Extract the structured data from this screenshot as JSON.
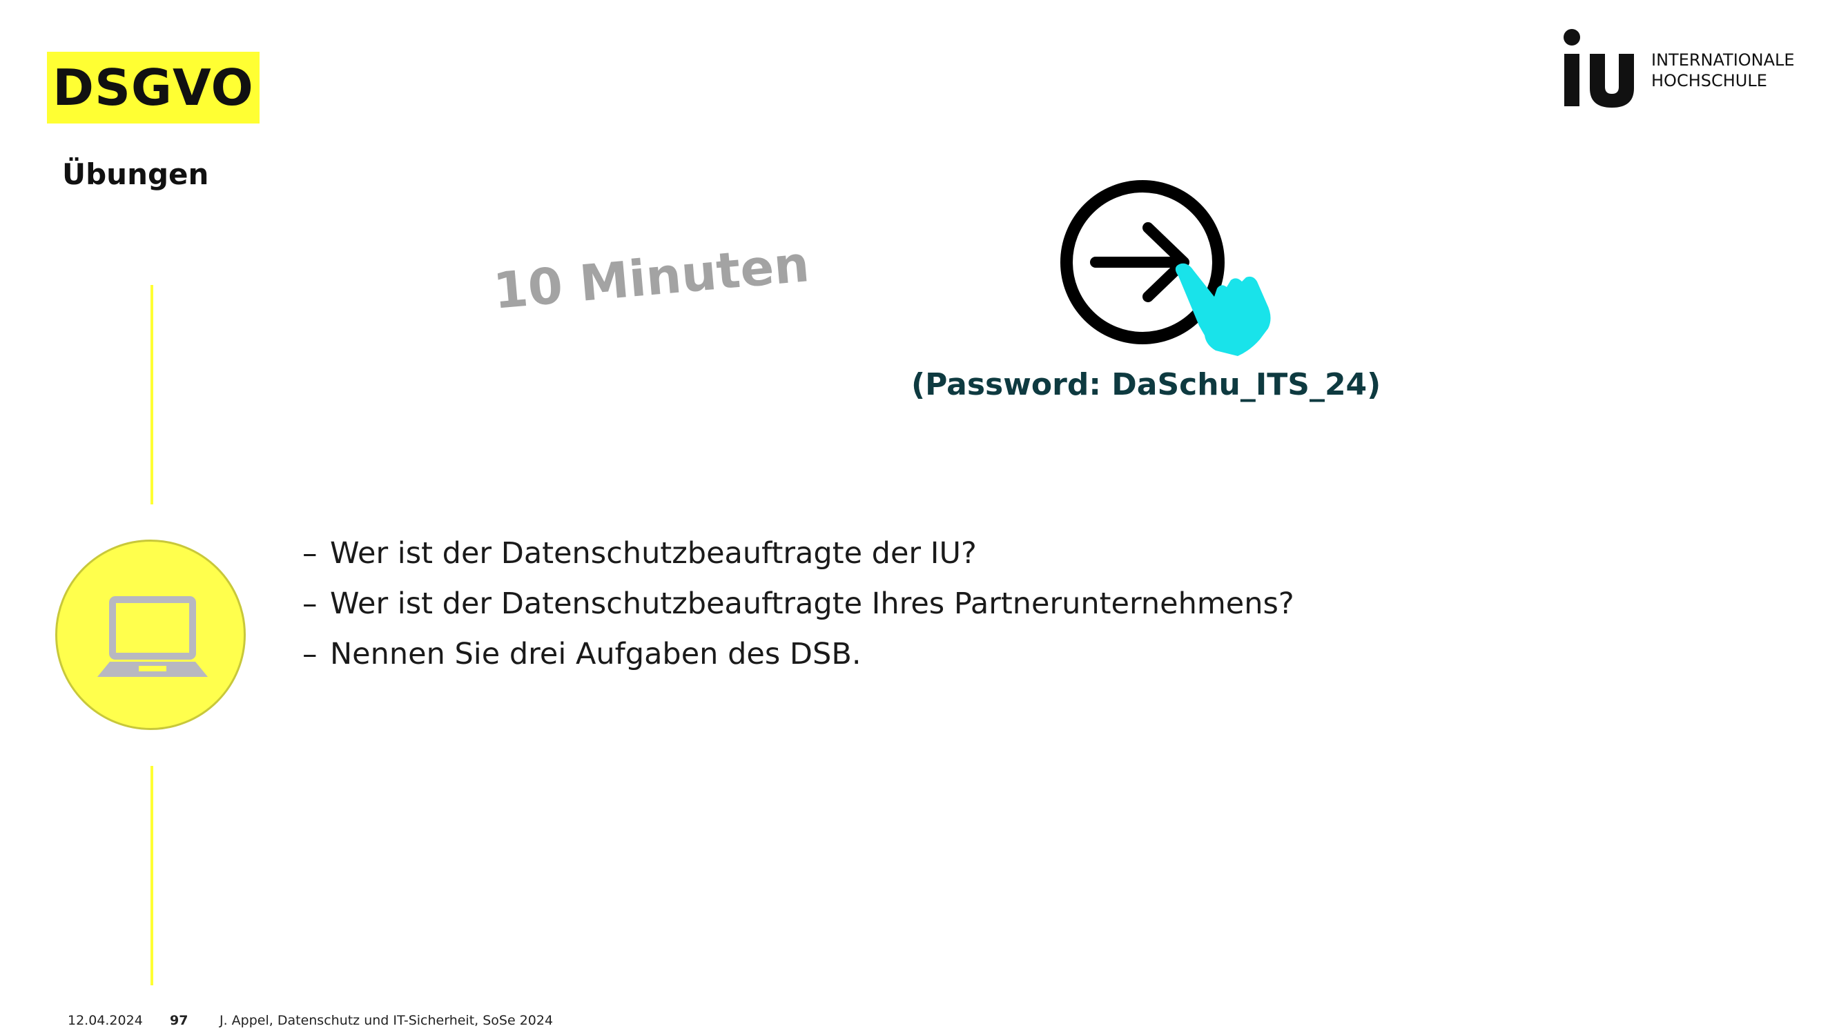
{
  "header": {
    "title": "DSGVO",
    "subtitle": "Übungen"
  },
  "logo": {
    "mark": "iu",
    "line1": "INTERNATIONALE",
    "line2": "HOCHSCHULE"
  },
  "exercise": {
    "duration": "10 Minuten",
    "password": "(Password: DaSchu_ITS_24)",
    "link_icon": "arrow-circle-icon",
    "pointer_icon": "pointing-hand-icon",
    "badge_icon": "laptop-icon"
  },
  "questions": [
    {
      "dash": "–",
      "text": "Wer ist der Datenschutzbeauftragte der IU?"
    },
    {
      "dash": "–",
      "text": "Wer ist der Datenschutzbeauftragte Ihres Partnerunternehmens?"
    },
    {
      "dash": "–",
      "text": "Nennen Sie drei Aufgaben des DSB."
    }
  ],
  "footer": {
    "date": "12.04.2024",
    "page": "97",
    "info": "J. Appel, Datenschutz und IT-Sicherheit, SoSe 2024"
  },
  "colors": {
    "accent_yellow": "#ffff33",
    "badge_yellow": "#ffff4d",
    "timer_gray": "#a3a3a3",
    "password_teal": "#0e3a40",
    "hand_cyan": "#19e3ea",
    "laptop_gray": "#b8b8c0"
  }
}
